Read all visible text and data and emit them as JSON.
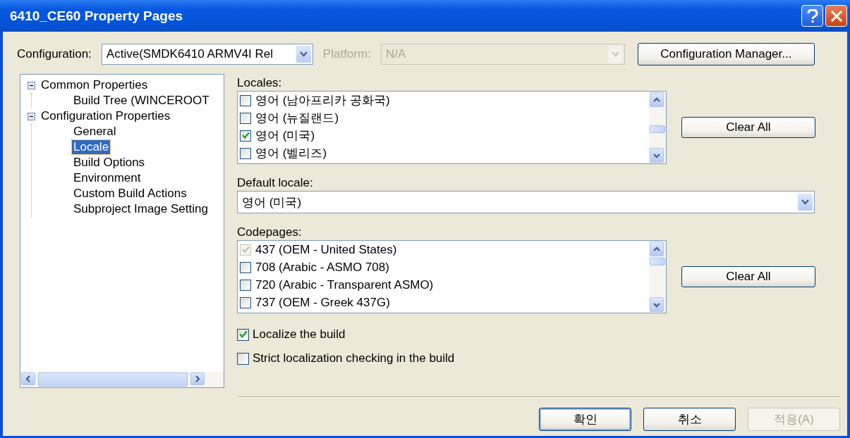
{
  "window": {
    "title": "6410_CE60 Property Pages"
  },
  "configuration": {
    "label": "Configuration:",
    "value": "Active(SMDK6410 ARMV4I Rel"
  },
  "platform": {
    "label": "Platform:",
    "value": "N/A",
    "disabled": true
  },
  "config_manager_button": "Configuration Manager...",
  "tree": [
    {
      "label": "Common Properties",
      "expanded": true,
      "selected": false,
      "children": [
        {
          "label": "Build Tree (WINCEROOT",
          "selected": false
        }
      ]
    },
    {
      "label": "Configuration Properties",
      "expanded": true,
      "selected": false,
      "children": [
        {
          "label": "General",
          "selected": false
        },
        {
          "label": "Locale",
          "selected": true
        },
        {
          "label": "Build Options",
          "selected": false
        },
        {
          "label": "Environment",
          "selected": false
        },
        {
          "label": "Custom Build Actions",
          "selected": false
        },
        {
          "label": "Subproject Image Setting",
          "selected": false
        }
      ]
    }
  ],
  "locales": {
    "label": "Locales:",
    "clear_button": "Clear All",
    "items": [
      {
        "label": "영어 (남아프리카 공화국)",
        "checked": false
      },
      {
        "label": "영어 (뉴질랜드)",
        "checked": false
      },
      {
        "label": "영어 (미국)",
        "checked": true
      },
      {
        "label": "영어 (벨리즈)",
        "checked": false
      }
    ]
  },
  "default_locale": {
    "label": "Default locale:",
    "value": "영어 (미국)"
  },
  "codepages": {
    "label": "Codepages:",
    "clear_button": "Clear All",
    "items": [
      {
        "label": "437  (OEM - United States)",
        "checked": true,
        "disabled": true
      },
      {
        "label": "708  (Arabic - ASMO 708)",
        "checked": false,
        "disabled": false
      },
      {
        "label": "720  (Arabic - Transparent ASMO)",
        "checked": false,
        "disabled": false
      },
      {
        "label": "737  (OEM - Greek 437G)",
        "checked": false,
        "disabled": false
      }
    ]
  },
  "options": [
    {
      "label": "Localize the build",
      "checked": true
    },
    {
      "label": "Strict localization checking in the build",
      "checked": false
    }
  ],
  "buttons": [
    {
      "label": "확인",
      "kind": "default",
      "disabled": false
    },
    {
      "label": "취소",
      "kind": "normal",
      "disabled": false
    },
    {
      "label": "적용(A)",
      "kind": "normal",
      "disabled": true
    }
  ]
}
